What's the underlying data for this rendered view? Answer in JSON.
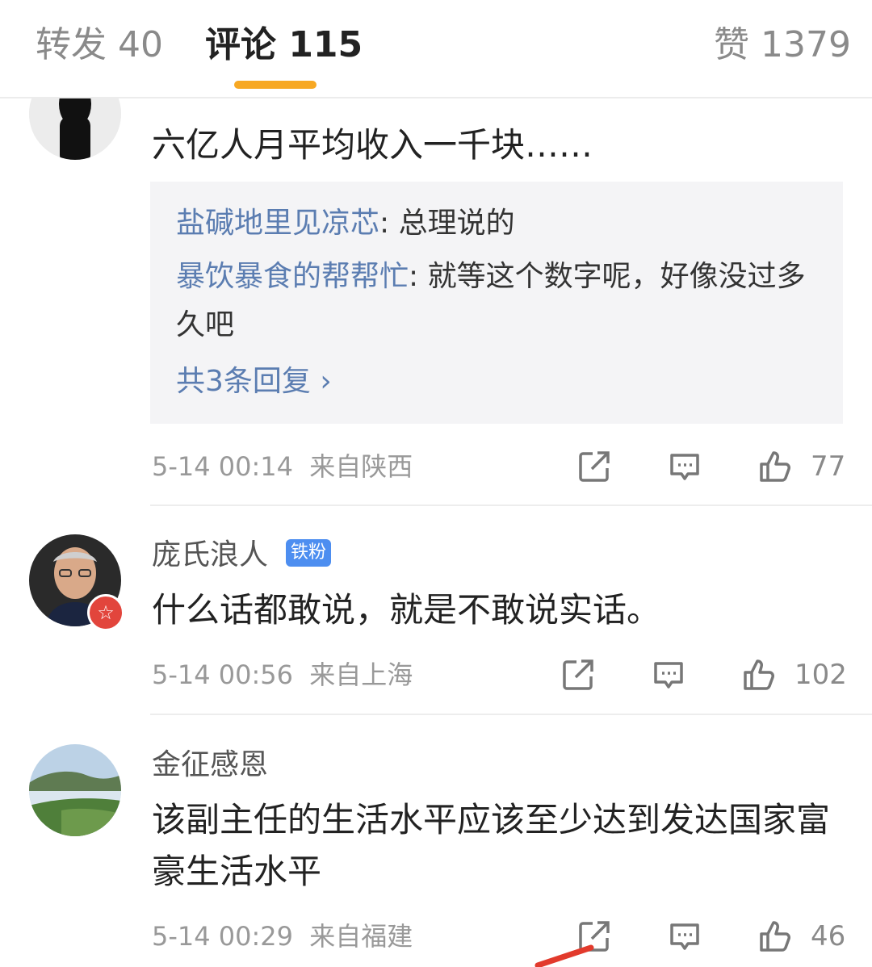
{
  "tabs": {
    "repost": "转发 40",
    "comments": "评论 115",
    "likes": "赞 1379"
  },
  "comments": [
    {
      "text": "六亿人月平均收入一千块……",
      "replies": [
        {
          "name": "盐碱地里见凉芯",
          "text": ": 总理说的"
        },
        {
          "name": "暴饮暴食的帮帮忙",
          "text": ": 就等这个数字呢，好像没过多久吧"
        }
      ],
      "more_replies": "共3条回复 ›",
      "time": "5-14 00:14",
      "location": "来自陕西",
      "likes": "77"
    },
    {
      "name": "庞氏浪人",
      "badge": "铁粉",
      "text": "什么话都敢说，就是不敢说实话。",
      "time": "5-14 00:56",
      "location": "来自上海",
      "likes": "102"
    },
    {
      "name": "金征感恩",
      "text": "该副主任的生活水平应该至少达到发达国家富豪生活水平",
      "time": "5-14 00:29",
      "location": "来自福建",
      "likes": "46"
    }
  ]
}
